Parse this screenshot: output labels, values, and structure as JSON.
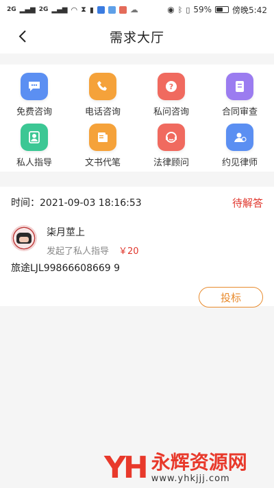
{
  "status_bar": {
    "signal1": "2G",
    "signal2": "2G",
    "battery_text": "59%",
    "battery_level": 0.59,
    "time": "傍晚5:42"
  },
  "nav": {
    "title": "需求大厅"
  },
  "services": [
    {
      "label": "免费咨询",
      "icon": "chat-bubble-icon",
      "color": "#5b8ff2"
    },
    {
      "label": "电话咨询",
      "icon": "phone-icon",
      "color": "#f5a23a"
    },
    {
      "label": "私问咨询",
      "icon": "question-icon",
      "color": "#f06a5f"
    },
    {
      "label": "合同审查",
      "icon": "document-icon",
      "color": "#9b7cf0"
    },
    {
      "label": "私人指导",
      "icon": "person-icon",
      "color": "#3cc794"
    },
    {
      "label": "文书代笔",
      "icon": "writing-icon",
      "color": "#f5a23a"
    },
    {
      "label": "法律顾问",
      "icon": "headset-icon",
      "color": "#f06a5f"
    },
    {
      "label": "约见律师",
      "icon": "meet-icon",
      "color": "#5b8ff2"
    }
  ],
  "request": {
    "time": "时间：2021-09-03 18:16:53",
    "status": "待解答",
    "username": "柒月莖上",
    "action": "发起了私人指导",
    "price": "￥20",
    "content": "旅途LJL99866608669  9",
    "bid_label": "投标"
  },
  "watermark": {
    "logo": "YH",
    "name": "永辉资源网",
    "url": "www.yhkjjj.com"
  }
}
